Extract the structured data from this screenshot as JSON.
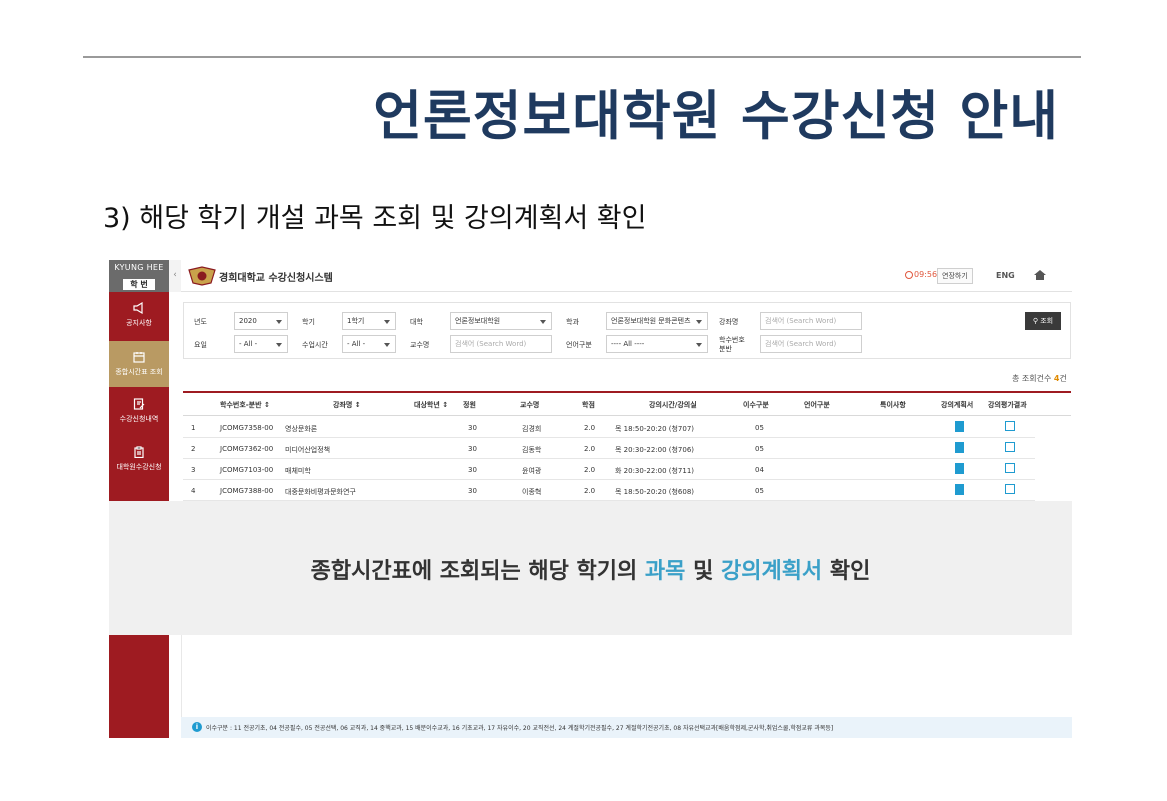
{
  "slide": {
    "title": "언론정보대학원 수강신청 안내",
    "subtitle": "3) 해당 학기 개설 과목 조회 및 강의계획서 확인"
  },
  "colors": {
    "brand_red": "#9e1b21",
    "title_navy": "#1f3a5f",
    "accent_blue": "#3aa0c8",
    "active_menu": "#b99a63"
  },
  "app": {
    "brand_top": "KYUNG HEE",
    "brand_badge": "학 번",
    "collapse_glyph": "‹",
    "system_title": "경희대학교 수강신청시스템",
    "timer": "09:56",
    "extend_label": "연장하기",
    "lang_label": "ENG"
  },
  "sidebar": {
    "items": [
      {
        "label": "공지사항",
        "icon": "megaphone-icon"
      },
      {
        "label": "종합시간표 조회",
        "icon": "calendar-icon",
        "active": true
      },
      {
        "label": "수강신청내역",
        "icon": "edit-doc-icon"
      },
      {
        "label": "대학원수강신청",
        "icon": "clipboard-icon"
      }
    ]
  },
  "filters": {
    "year_label": "년도",
    "year_value": "2020",
    "term_label": "학기",
    "term_value": "1학기",
    "college_label": "대학",
    "college_value": "언론정보대학원",
    "dept_label": "학과",
    "dept_value": "언론정보대학원 문화콘텐츠",
    "course_name_label": "강좌명",
    "course_name_placeholder": "검색어 (Search Word)",
    "day_label": "요일",
    "day_value": "- All -",
    "class_time_label": "수업시간",
    "class_time_value": "- All -",
    "professor_label": "교수명",
    "professor_placeholder": "검색어 (Search Word)",
    "language_label": "언어구분",
    "language_value": "---- All ----",
    "course_no_label_1": "학수번호",
    "course_no_label_2": "분반",
    "course_no_placeholder": "검색어 (Search Word)",
    "search_button": "조회"
  },
  "result": {
    "total_prefix": "총 조회건수",
    "total_count": "4",
    "total_suffix": "건"
  },
  "table": {
    "headers": {
      "course_no": "학수번호-분반 ↕",
      "course_name": "강좌명 ↕",
      "target_year": "대상학년 ↕",
      "capacity": "정원",
      "professor": "교수명",
      "credit": "학점",
      "time_room": "강의시간/강의실",
      "completion_type": "이수구분",
      "language": "언어구분",
      "remarks": "특이사항",
      "syllabus": "강의계획서",
      "evaluation": "강의평가결과"
    },
    "rows": [
      {
        "no": "1",
        "code": "JCOMG7358-00",
        "name": "영상문화론",
        "capacity": "30",
        "professor": "김경희",
        "credit": "2.0",
        "time": "목 18:50-20:20 (청707)",
        "type": "05"
      },
      {
        "no": "2",
        "code": "JCOMG7362-00",
        "name": "미디어산업정책",
        "capacity": "30",
        "professor": "김동학",
        "credit": "2.0",
        "time": "목 20:30-22:00 (청706)",
        "type": "05"
      },
      {
        "no": "3",
        "code": "JCOMG7103-00",
        "name": "매체미학",
        "capacity": "30",
        "professor": "윤여광",
        "credit": "2.0",
        "time": "화 20:30-22:00 (청711)",
        "type": "04"
      },
      {
        "no": "4",
        "code": "JCOMG7388-00",
        "name": "대중문화비평과문화연구",
        "capacity": "30",
        "professor": "이종혁",
        "credit": "2.0",
        "time": "목 18:50-20:20 (청608)",
        "type": "05"
      }
    ]
  },
  "overlay": {
    "text_1": "종합시간표에 조회되는 해당 학기의 ",
    "highlight_1": "과목",
    "text_2": " 및 ",
    "highlight_2": "강의계획서",
    "text_3": " 확인"
  },
  "footnote": {
    "info_glyph": "i",
    "text": "이수구분 : 11 전공기초, 04 전공필수, 05 전공선택, 06 교직과, 14 중핵교과, 15 배분이수교과, 16 기초교과, 17 자유이수, 20 교직전선, 24 계절학기전공필수, 27 계절학기전공기초, 08 자유선택교과[배움학점제,군사학,취업스쿨,학점교류 과목등]"
  }
}
